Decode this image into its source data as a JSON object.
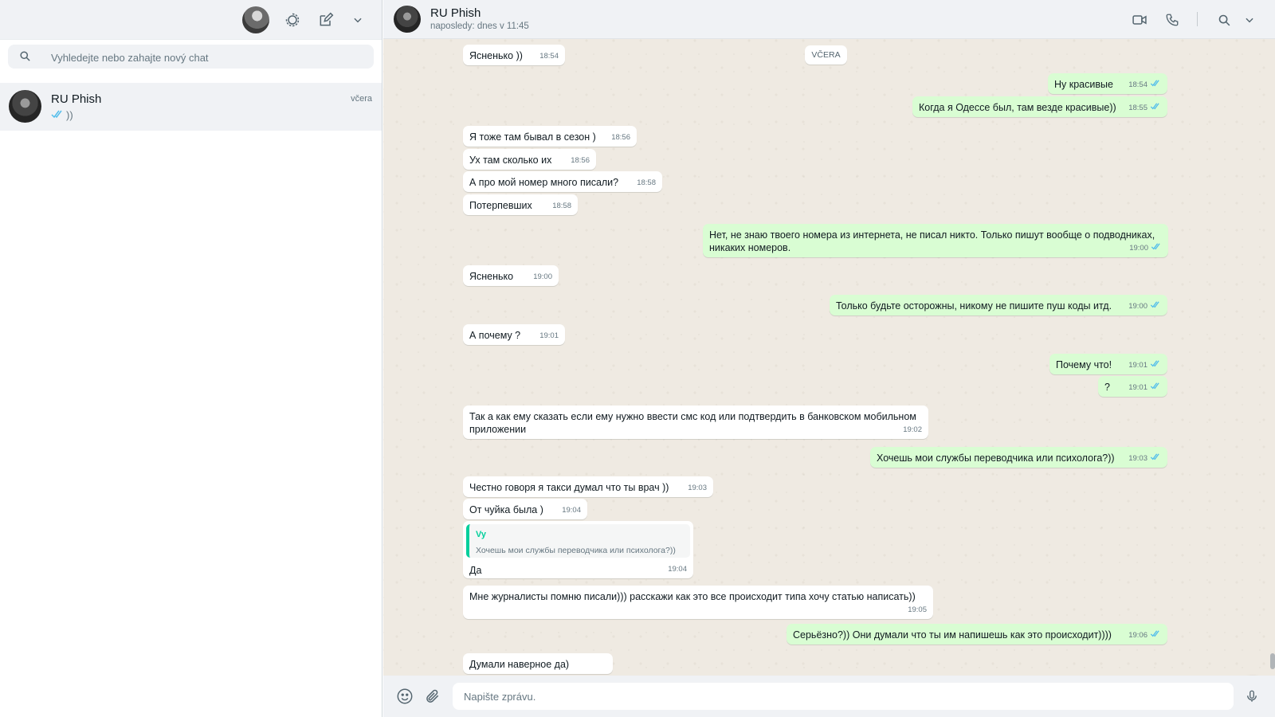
{
  "sidebar": {
    "search_placeholder": "Vyhledejte nebo zahajte nový chat",
    "chats": [
      {
        "name": "RU Phish",
        "time": "včera",
        "preview": "))"
      }
    ]
  },
  "conversation": {
    "name": "RU Phish",
    "status": "naposledy: dnes v 11:45",
    "date_chip": "VČERA",
    "messages": [
      {
        "dir": "in",
        "text": "Ясненько ))",
        "time": "18:54"
      },
      {
        "dir": "out",
        "text": "Ну красивые",
        "time": "18:54"
      },
      {
        "dir": "out",
        "text": "Когда я Одессе был, там везде красивые))",
        "time": "18:55"
      },
      {
        "dir": "in",
        "text": "Я тоже там бывал в сезон )",
        "time": "18:56"
      },
      {
        "dir": "in",
        "text": "Ух там сколько их",
        "time": "18:56"
      },
      {
        "dir": "in",
        "text": "А про мой номер много писали?",
        "time": "18:58"
      },
      {
        "dir": "in",
        "text": "Потерпевших",
        "time": "18:58"
      },
      {
        "dir": "out",
        "text": "Нет, не знаю твоего номера из интернета, не писал никто. Только пишут вообще о подводниках, никаких номеров.",
        "time": "19:00"
      },
      {
        "dir": "in",
        "text": "Ясненько",
        "time": "19:00"
      },
      {
        "dir": "out",
        "text": "Только будьте осторожны, никому не пишите пуш коды итд.",
        "time": "19:00"
      },
      {
        "dir": "in",
        "text": "А почему ?",
        "time": "19:01"
      },
      {
        "dir": "out",
        "text": "Почему что!",
        "time": "19:01"
      },
      {
        "dir": "out",
        "text": "?",
        "time": "19:01"
      },
      {
        "dir": "in",
        "text": "Так а как ему сказать если ему нужно ввести смс код или подтвердить в банковском мобильном приложении",
        "time": "19:02"
      },
      {
        "dir": "out",
        "text": "Хочешь мои службы переводчика или психолога?))",
        "time": "19:03"
      },
      {
        "dir": "in",
        "text": "Честно говоря я такси думал что ты врач ))",
        "time": "19:03"
      },
      {
        "dir": "in",
        "text": "От чуйка была )",
        "time": "19:04"
      },
      {
        "dir": "in",
        "text": "Да",
        "time": "19:04",
        "quote_author": "Vy",
        "quote_text": "Хочешь мои службы переводчика или психолога?))"
      },
      {
        "dir": "in",
        "text": "Мне журналисты помню писали))) расскажи как это все происходит типа хочу статью написать))",
        "time": "19:05"
      },
      {
        "dir": "out",
        "text": "Серьёзно?)) Они думали что ты им напишешь как это происходит))))",
        "time": "19:06"
      },
      {
        "dir": "in",
        "text": "Думали наверное да)",
        "time": ""
      }
    ]
  },
  "composer": {
    "placeholder": "Napište zprávu."
  },
  "icons": {
    "status": "status-icon",
    "new_chat": "new-chat-icon",
    "menu": "chevron-down-icon",
    "search": "search-icon",
    "video": "video-call-icon",
    "phone": "phone-icon",
    "emoji": "emoji-icon",
    "attach": "attach-icon",
    "mic": "microphone-icon",
    "read": "double-check-icon"
  },
  "colors": {
    "incoming_bubble": "#ffffff",
    "outgoing_bubble": "#d9fdd3",
    "read_tick": "#53bdeb",
    "chat_bg": "#efeae2",
    "quote_accent": "#06cf9c"
  }
}
